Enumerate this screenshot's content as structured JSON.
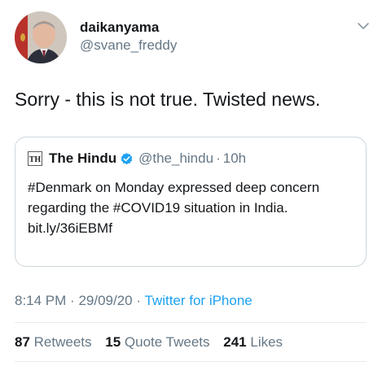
{
  "author": {
    "display_name": "daikanyama",
    "handle": "@svane_freddy"
  },
  "tweet": {
    "text": "Sorry - this is not true. Twisted news."
  },
  "quoted_tweet": {
    "source_name": "The Hindu",
    "handle": "@the_hindu",
    "separator": "·",
    "time": "10h",
    "body": "#Denmark on Monday expressed deep concern regarding the #COVID19 situation in India.",
    "link": "bit.ly/36iEBMf"
  },
  "meta": {
    "time": "8:14 PM",
    "dot1": "·",
    "date": "29/09/20",
    "dot2": "·",
    "client": "Twitter for iPhone"
  },
  "stats": {
    "retweets_count": "87",
    "retweets_label": "Retweets",
    "quotes_count": "15",
    "quotes_label": "Quote Tweets",
    "likes_count": "241",
    "likes_label": "Likes"
  },
  "colors": {
    "link_blue": "#1da1f2",
    "secondary_gray": "#657786",
    "verified_blue": "#1da1f2"
  },
  "icons": {
    "chevron": "chevron-down-icon",
    "verified": "verified-badge-icon",
    "source_logo": "the-hindu-logo-icon"
  }
}
